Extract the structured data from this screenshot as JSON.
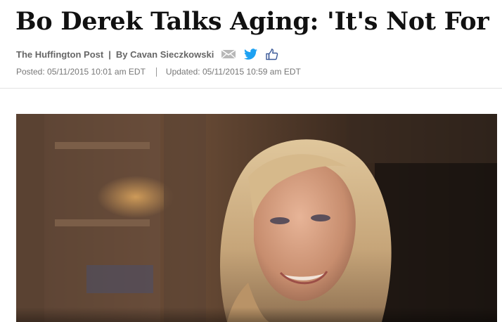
{
  "article": {
    "headline": "Bo Derek Talks Aging: 'It's Not For",
    "source": "The Huffington Post",
    "separator": "|",
    "author": "By Cavan Sieczkowski",
    "posted": "Posted: 05/11/2015 10:01 am EDT",
    "updated": "Updated: 05/11/2015 10:59 am EDT"
  },
  "share_icons": [
    "mail-icon",
    "twitter-icon",
    "facebook-like-icon"
  ],
  "colors": {
    "headline": "#111111",
    "byline": "#666666",
    "timestamp": "#777777",
    "twitter": "#1da1f2",
    "facebook": "#3b5998",
    "mail": "#9a9a9a"
  }
}
